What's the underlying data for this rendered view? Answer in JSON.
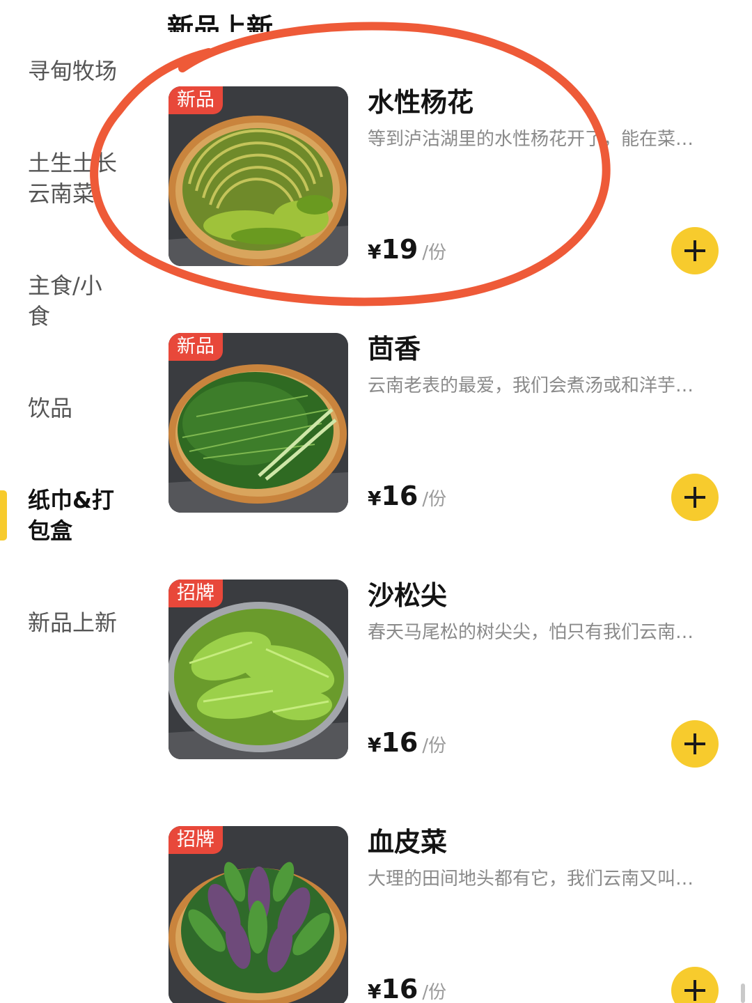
{
  "header": {
    "section_title_clipped": "新品上新"
  },
  "sidebar": {
    "items": [
      {
        "label": "寻甸牧场"
      },
      {
        "label": "土生土长云南菜"
      },
      {
        "label": "主食/小食"
      },
      {
        "label": "饮品"
      },
      {
        "label": "纸巾&打包盒",
        "active": true
      },
      {
        "label": "新品上新"
      }
    ]
  },
  "products": [
    {
      "badge": "新品",
      "name": "水性杨花",
      "desc": "等到泸沽湖里的水性杨花开了，能在菜…",
      "currency": "¥",
      "price": "19",
      "unit": "/份",
      "image": "swirled-green-stems-in-bamboo-basket"
    },
    {
      "badge": "新品",
      "name": "茴香",
      "desc": "云南老表的最爱，我们会煮汤或和洋芋…",
      "currency": "¥",
      "price": "16",
      "unit": "/份",
      "image": "feathery-fennel-in-bamboo-basket"
    },
    {
      "badge": "招牌",
      "name": "沙松尖",
      "desc": "春天马尾松的树尖尖，怕只有我们云南…",
      "currency": "¥",
      "price": "16",
      "unit": "/份",
      "image": "light-green-pine-tips-on-plate"
    },
    {
      "badge": "招牌",
      "name": "血皮菜",
      "desc": "大理的田间地头都有它，我们云南又叫…",
      "currency": "¥",
      "price": "16",
      "unit": "/份",
      "image": "purple-green-leaves-in-basket"
    }
  ],
  "colors": {
    "accent_yellow": "#f7cb2d",
    "badge_red": "#e8483a",
    "annotation_red": "#ee5a38"
  }
}
